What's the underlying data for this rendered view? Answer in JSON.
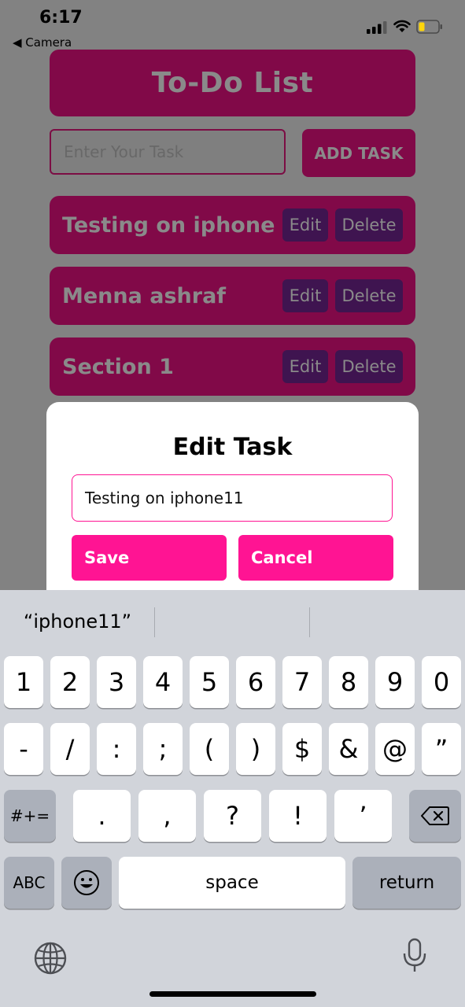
{
  "status_bar": {
    "time": "6:17",
    "back_label": "◀ Camera",
    "icons": [
      "cellular-signal-icon",
      "wifi-icon",
      "battery-icon"
    ]
  },
  "app": {
    "title": "To-Do List",
    "input_placeholder": "Enter Your Task",
    "add_button": "ADD TASK",
    "tasks": [
      {
        "name": "Testing on iphone",
        "edit": "Edit",
        "delete": "Delete"
      },
      {
        "name": "Menna ashraf",
        "edit": "Edit",
        "delete": "Delete"
      },
      {
        "name": "Section 1",
        "edit": "Edit",
        "delete": "Delete"
      }
    ]
  },
  "modal": {
    "title": "Edit Task",
    "input_value": "Testing on iphone11",
    "save_label": "Save",
    "cancel_label": "Cancel"
  },
  "keyboard": {
    "suggestions": [
      "“iphone11”",
      "",
      ""
    ],
    "row1": [
      "1",
      "2",
      "3",
      "4",
      "5",
      "6",
      "7",
      "8",
      "9",
      "0"
    ],
    "row2": [
      "-",
      "/",
      ":",
      ";",
      "(",
      ")",
      "$",
      "&",
      "@",
      "”"
    ],
    "row3_left": "#+=",
    "row3": [
      ".",
      ",",
      "?",
      "!",
      "’"
    ],
    "abc": "ABC",
    "space": "space",
    "return": "return",
    "icons": [
      "backspace-icon",
      "emoji-icon",
      "globe-icon",
      "microphone-icon"
    ]
  },
  "colors": {
    "accent": "#ff1493",
    "dim_accent": "#810948",
    "dim_button": "#3f1450",
    "overlay": "#828282"
  }
}
